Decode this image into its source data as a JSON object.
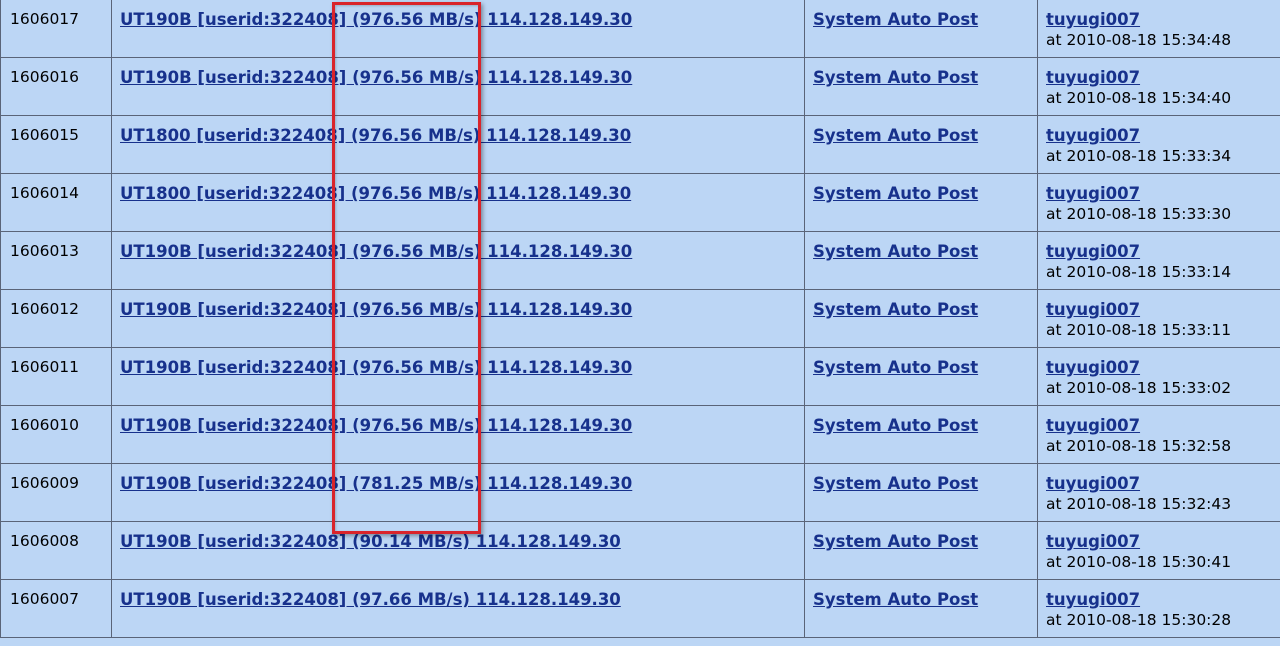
{
  "rows": [
    {
      "id": "1606017",
      "subject": "UT190B [userid:322408] (976.56 MB/s) 114.128.149.30",
      "author": "System Auto Post",
      "user": "tuyugi007",
      "time": "at 2010-08-18 15:34:48"
    },
    {
      "id": "1606016",
      "subject": "UT190B [userid:322408] (976.56 MB/s) 114.128.149.30",
      "author": "System Auto Post",
      "user": "tuyugi007",
      "time": "at 2010-08-18 15:34:40"
    },
    {
      "id": "1606015",
      "subject": "UT1800 [userid:322408] (976.56 MB/s) 114.128.149.30",
      "author": "System Auto Post",
      "user": "tuyugi007",
      "time": "at 2010-08-18 15:33:34"
    },
    {
      "id": "1606014",
      "subject": "UT1800 [userid:322408] (976.56 MB/s) 114.128.149.30",
      "author": "System Auto Post",
      "user": "tuyugi007",
      "time": "at 2010-08-18 15:33:30"
    },
    {
      "id": "1606013",
      "subject": "UT190B [userid:322408] (976.56 MB/s) 114.128.149.30",
      "author": "System Auto Post",
      "user": "tuyugi007",
      "time": "at 2010-08-18 15:33:14"
    },
    {
      "id": "1606012",
      "subject": "UT190B [userid:322408] (976.56 MB/s) 114.128.149.30",
      "author": "System Auto Post",
      "user": "tuyugi007",
      "time": "at 2010-08-18 15:33:11"
    },
    {
      "id": "1606011",
      "subject": "UT190B [userid:322408] (976.56 MB/s) 114.128.149.30",
      "author": "System Auto Post",
      "user": "tuyugi007",
      "time": "at 2010-08-18 15:33:02"
    },
    {
      "id": "1606010",
      "subject": "UT190B [userid:322408] (976.56 MB/s) 114.128.149.30",
      "author": "System Auto Post",
      "user": "tuyugi007",
      "time": "at 2010-08-18 15:32:58"
    },
    {
      "id": "1606009",
      "subject": "UT190B [userid:322408] (781.25 MB/s) 114.128.149.30",
      "author": "System Auto Post",
      "user": "tuyugi007",
      "time": "at 2010-08-18 15:32:43"
    },
    {
      "id": "1606008",
      "subject": "UT190B [userid:322408] (90.14 MB/s) 114.128.149.30",
      "author": "System Auto Post",
      "user": "tuyugi007",
      "time": "at 2010-08-18 15:30:41"
    },
    {
      "id": "1606007",
      "subject": "UT190B [userid:322408] (97.66 MB/s) 114.128.149.30",
      "author": "System Auto Post",
      "user": "tuyugi007",
      "time": "at 2010-08-18 15:30:28"
    }
  ],
  "colors": {
    "background": "#bcd6f5",
    "link": "#17318c",
    "grid": "#5a6478",
    "highlight": "#d9242b"
  }
}
